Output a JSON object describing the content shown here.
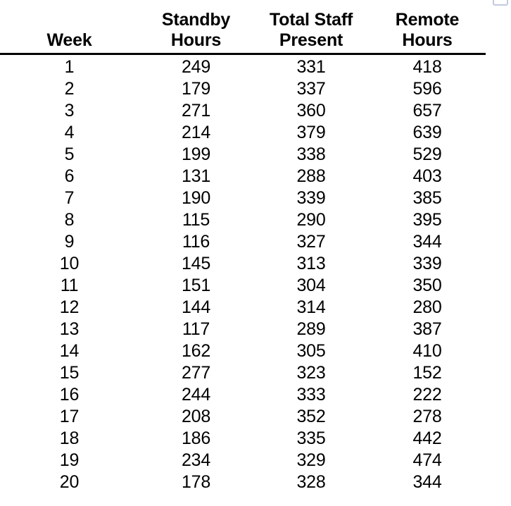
{
  "document": {
    "type": "data-table",
    "background_color": "#ffffff",
    "text_color": "#000000",
    "rule_color": "#000000"
  },
  "corner_widget": {
    "name": "clipped-ui-frame",
    "border_color": "#c2c9de"
  },
  "table": {
    "columns": [
      {
        "key": "week",
        "label": "Week",
        "align": "center"
      },
      {
        "key": "standby",
        "label": "Standby\nHours",
        "align": "center"
      },
      {
        "key": "total",
        "label": "Total Staff\nPresent",
        "align": "center"
      },
      {
        "key": "remote",
        "label": "Remote\nHours",
        "align": "center"
      }
    ],
    "rows": [
      {
        "week": "1",
        "standby": "249",
        "total": "331",
        "remote": "418"
      },
      {
        "week": "2",
        "standby": "179",
        "total": "337",
        "remote": "596"
      },
      {
        "week": "3",
        "standby": "271",
        "total": "360",
        "remote": "657"
      },
      {
        "week": "4",
        "standby": "214",
        "total": "379",
        "remote": "639"
      },
      {
        "week": "5",
        "standby": "199",
        "total": "338",
        "remote": "529"
      },
      {
        "week": "6",
        "standby": "131",
        "total": "288",
        "remote": "403"
      },
      {
        "week": "7",
        "standby": "190",
        "total": "339",
        "remote": "385"
      },
      {
        "week": "8",
        "standby": "115",
        "total": "290",
        "remote": "395"
      },
      {
        "week": "9",
        "standby": "116",
        "total": "327",
        "remote": "344"
      },
      {
        "week": "10",
        "standby": "145",
        "total": "313",
        "remote": "339"
      },
      {
        "week": "11",
        "standby": "151",
        "total": "304",
        "remote": "350"
      },
      {
        "week": "12",
        "standby": "144",
        "total": "314",
        "remote": "280"
      },
      {
        "week": "13",
        "standby": "117",
        "total": "289",
        "remote": "387"
      },
      {
        "week": "14",
        "standby": "162",
        "total": "305",
        "remote": "410"
      },
      {
        "week": "15",
        "standby": "277",
        "total": "323",
        "remote": "152"
      },
      {
        "week": "16",
        "standby": "244",
        "total": "333",
        "remote": "222"
      },
      {
        "week": "17",
        "standby": "208",
        "total": "352",
        "remote": "278"
      },
      {
        "week": "18",
        "standby": "186",
        "total": "335",
        "remote": "442"
      },
      {
        "week": "19",
        "standby": "234",
        "total": "329",
        "remote": "474"
      },
      {
        "week": "20",
        "standby": "178",
        "total": "328",
        "remote": "344"
      }
    ]
  },
  "chart_data": {
    "type": "table",
    "title": "",
    "columns": [
      "Week",
      "Standby Hours",
      "Total Staff Present",
      "Remote Hours"
    ],
    "categories": [
      1,
      2,
      3,
      4,
      5,
      6,
      7,
      8,
      9,
      10,
      11,
      12,
      13,
      14,
      15,
      16,
      17,
      18,
      19,
      20
    ],
    "series": [
      {
        "name": "Standby Hours",
        "values": [
          249,
          179,
          271,
          214,
          199,
          131,
          190,
          115,
          116,
          145,
          151,
          144,
          117,
          162,
          277,
          244,
          208,
          186,
          234,
          178
        ]
      },
      {
        "name": "Total Staff Present",
        "values": [
          331,
          337,
          360,
          379,
          338,
          288,
          339,
          290,
          327,
          313,
          304,
          314,
          289,
          305,
          323,
          333,
          352,
          335,
          329,
          328
        ]
      },
      {
        "name": "Remote Hours",
        "values": [
          418,
          596,
          657,
          639,
          529,
          403,
          385,
          395,
          344,
          339,
          350,
          280,
          387,
          410,
          152,
          222,
          278,
          442,
          474,
          344
        ]
      }
    ],
    "xlabel": "Week",
    "ylabel": "Hours"
  }
}
